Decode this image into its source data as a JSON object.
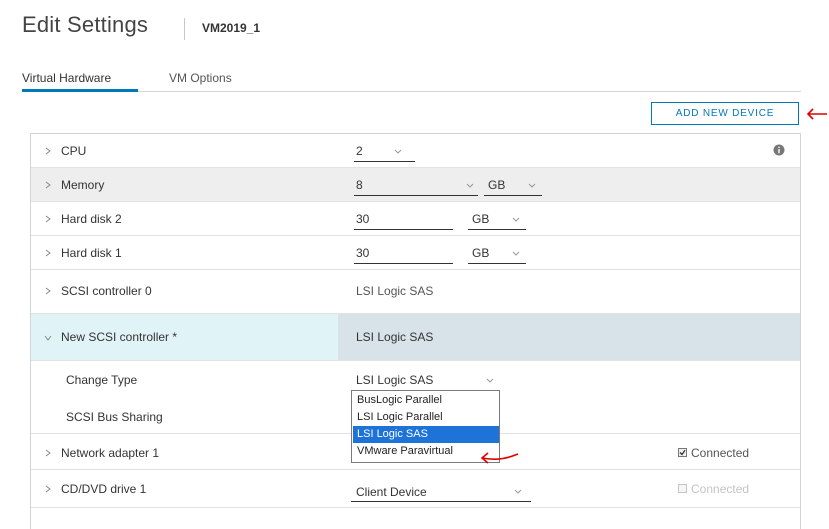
{
  "header": {
    "title": "Edit Settings",
    "vm_name": "VM2019_1"
  },
  "tabs": [
    {
      "label": "Virtual Hardware",
      "active": true
    },
    {
      "label": "VM Options",
      "active": false
    }
  ],
  "toolbar": {
    "add_device_label": "ADD NEW DEVICE"
  },
  "colors": {
    "accent": "#0079b8",
    "annotation": "#e00000",
    "selection": "#1e73d8"
  },
  "rows": {
    "cpu": {
      "label": "CPU",
      "value": "2"
    },
    "memory": {
      "label": "Memory",
      "value": "8",
      "unit": "GB"
    },
    "hard_disk_2": {
      "label": "Hard disk 2",
      "value": "30",
      "unit": "GB"
    },
    "hard_disk_1": {
      "label": "Hard disk 1",
      "value": "30",
      "unit": "GB"
    },
    "scsi_controller_0": {
      "label": "SCSI controller 0",
      "value": "LSI Logic SAS"
    },
    "new_scsi_controller": {
      "label": "New SCSI controller *",
      "value": "LSI Logic SAS"
    },
    "change_type": {
      "label": "Change Type",
      "value": "LSI Logic SAS"
    },
    "scsi_bus_sharing": {
      "label": "SCSI Bus Sharing"
    },
    "network_adapter_1": {
      "label": "Network adapter 1",
      "connected_label": "Connected",
      "connected": true
    },
    "cd_dvd_drive_1": {
      "label": "CD/DVD drive 1",
      "value": "Client Device",
      "connected_label": "Connected",
      "connected": false
    }
  },
  "change_type_options": [
    "BusLogic Parallel",
    "LSI Logic Parallel",
    "LSI Logic SAS",
    "VMware Paravirtual"
  ],
  "change_type_selected_index": 2
}
